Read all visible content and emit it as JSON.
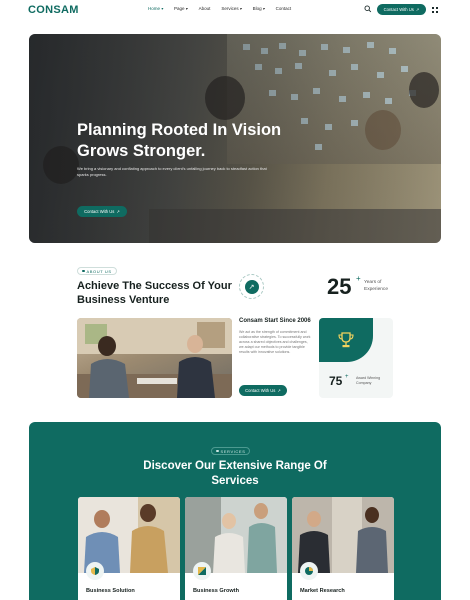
{
  "header": {
    "logo": "CONSAM",
    "nav": [
      {
        "label": "Home",
        "has_dropdown": true,
        "active": true
      },
      {
        "label": "Page",
        "has_dropdown": true,
        "active": false
      },
      {
        "label": "About",
        "has_dropdown": false,
        "active": false
      },
      {
        "label": "Services",
        "has_dropdown": true,
        "active": false
      },
      {
        "label": "Blog",
        "has_dropdown": true,
        "active": false
      },
      {
        "label": "Contact",
        "has_dropdown": false,
        "active": false
      }
    ],
    "cta_label": "Contact With Us",
    "accent": "#0f6b61"
  },
  "hero": {
    "title": "Planning Rooted In Vision Grows Stronger.",
    "subtitle": "We bring a visionary and conflating approach to every client's unfalling journey back to steadfast action that sparks progress.",
    "cta_label": "Contact With Us"
  },
  "about": {
    "tag": "ABOUT US",
    "title": "Achieve The Success Of Your Business Venture",
    "years_number": "25",
    "years_plus": "+",
    "years_label": "Years of Experience",
    "since_title": "Consam Start Since 2006",
    "since_desc": "We act as the strength of commitment and collaborative strategies. To successfully work across a shared objectives and challenges, we adapt our methods to provide tangible results with innovative solutions.",
    "cta_label": "Contact With Us",
    "award_number": "75",
    "award_plus": "+",
    "award_label": "Award Winning Company"
  },
  "services": {
    "tag": "SERVICES",
    "title": "Discover Our Extensive Range Of Services",
    "cards": [
      {
        "label": "Business Solution",
        "icon": "shield-icon"
      },
      {
        "label": "Business Growth",
        "icon": "chart-icon"
      },
      {
        "label": "Market Research",
        "icon": "pie-chart-icon"
      }
    ]
  }
}
